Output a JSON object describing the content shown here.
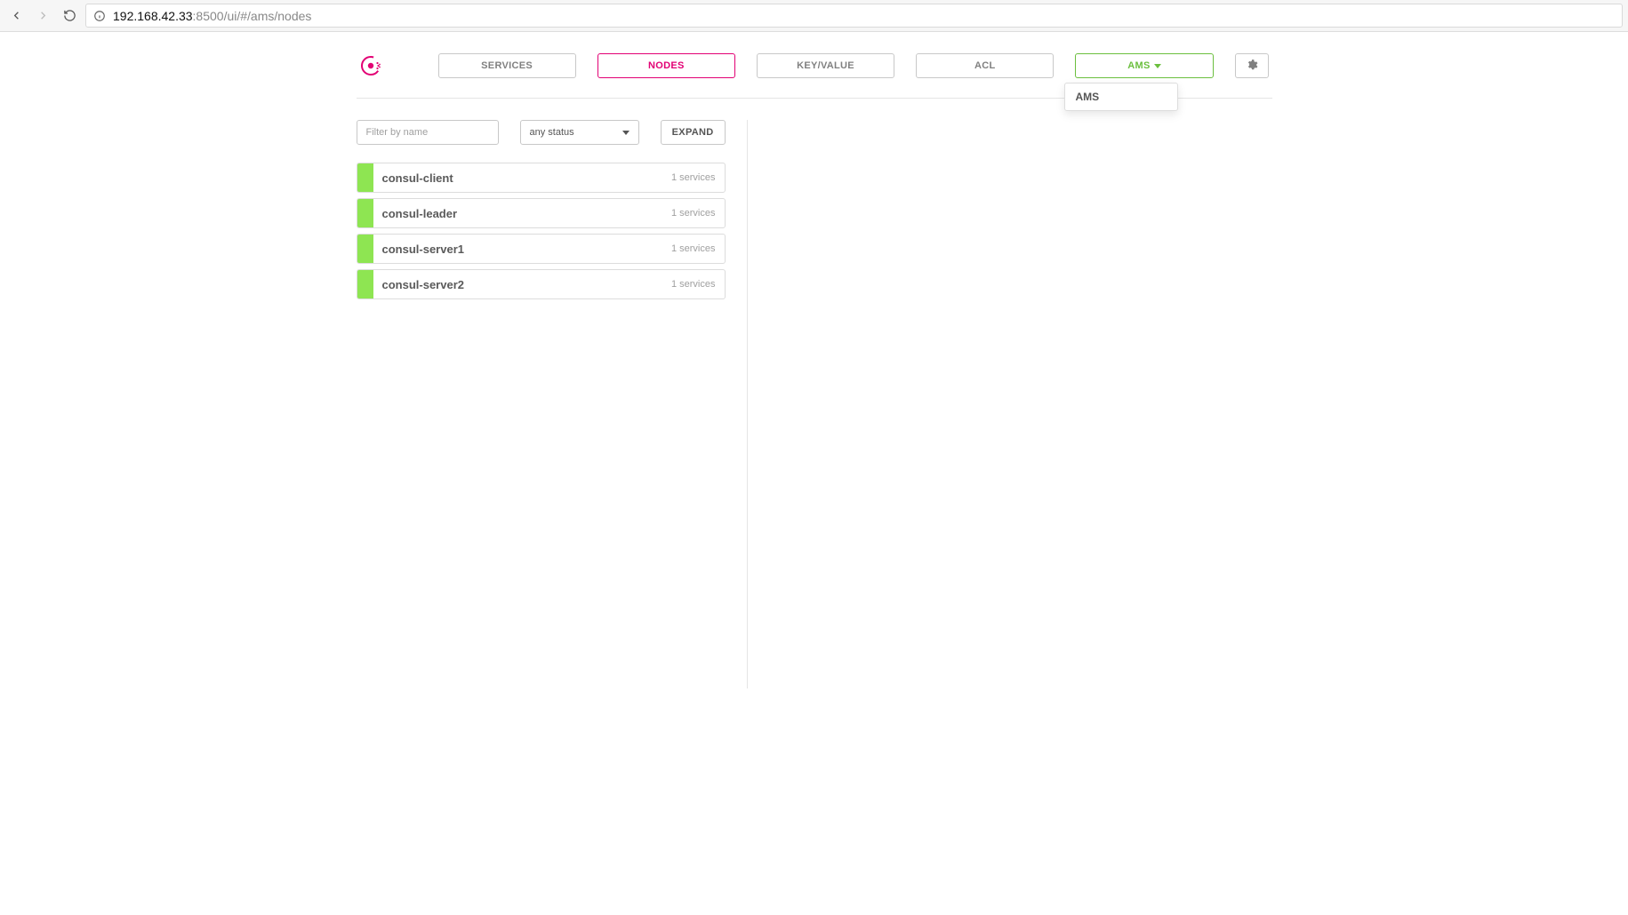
{
  "chrome": {
    "url_host": "192.168.42.33",
    "url_rest": ":8500/ui/#/ams/nodes"
  },
  "nav": {
    "services": "SERVICES",
    "nodes": "NODES",
    "kv": "KEY/VALUE",
    "acl": "ACL",
    "dc": "AMS"
  },
  "dc_dropdown": {
    "items": [
      "AMS"
    ]
  },
  "filter": {
    "placeholder": "Filter by name",
    "status": "any status",
    "expand": "EXPAND"
  },
  "nodes": [
    {
      "name": "consul-client",
      "services": "1 services"
    },
    {
      "name": "consul-leader",
      "services": "1 services"
    },
    {
      "name": "consul-server1",
      "services": "1 services"
    },
    {
      "name": "consul-server2",
      "services": "1 services"
    }
  ]
}
